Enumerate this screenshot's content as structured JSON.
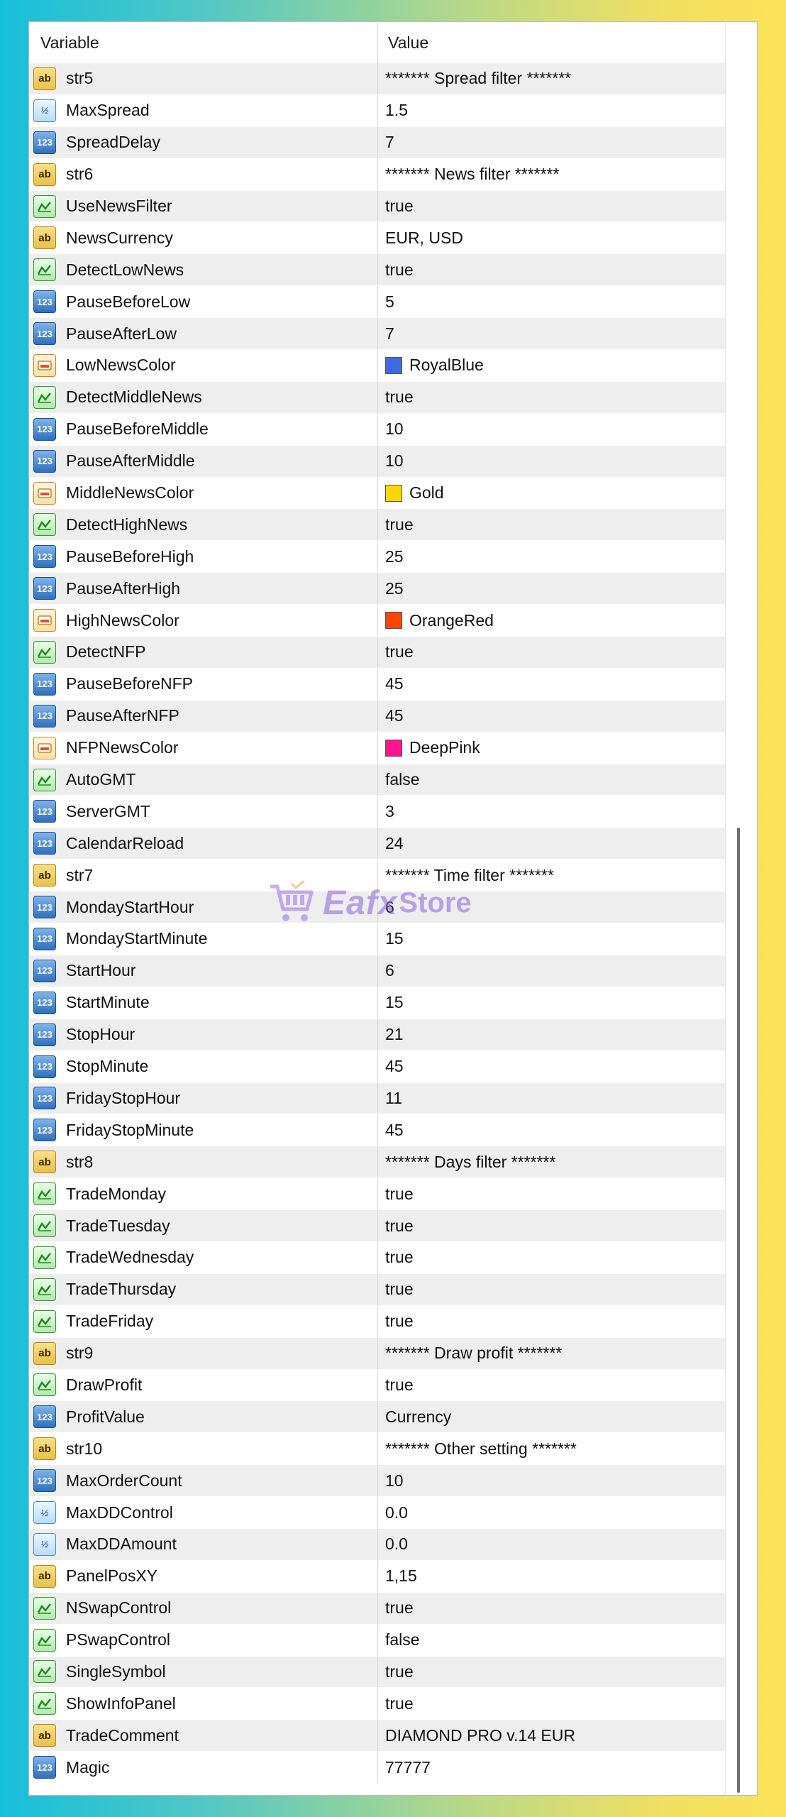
{
  "columns": {
    "variable": "Variable",
    "value": "Value"
  },
  "rows": [
    {
      "type": "string",
      "name": "str5",
      "value": "******* Spread filter *******"
    },
    {
      "type": "double",
      "name": "MaxSpread",
      "value": "1.5"
    },
    {
      "type": "int",
      "name": "SpreadDelay",
      "value": "7"
    },
    {
      "type": "string",
      "name": "str6",
      "value": "******* News filter *******"
    },
    {
      "type": "bool",
      "name": "UseNewsFilter",
      "value": "true"
    },
    {
      "type": "string",
      "name": "NewsCurrency",
      "value": "EUR, USD"
    },
    {
      "type": "bool",
      "name": "DetectLowNews",
      "value": "true"
    },
    {
      "type": "int",
      "name": "PauseBeforeLow",
      "value": "5"
    },
    {
      "type": "int",
      "name": "PauseAfterLow",
      "value": "7"
    },
    {
      "type": "color",
      "name": "LowNewsColor",
      "value": "RoyalBlue",
      "swatch": "#4169e1"
    },
    {
      "type": "bool",
      "name": "DetectMiddleNews",
      "value": "true"
    },
    {
      "type": "int",
      "name": "PauseBeforeMiddle",
      "value": "10"
    },
    {
      "type": "int",
      "name": "PauseAfterMiddle",
      "value": "10"
    },
    {
      "type": "color",
      "name": "MiddleNewsColor",
      "value": "Gold",
      "swatch": "#ffd700"
    },
    {
      "type": "bool",
      "name": "DetectHighNews",
      "value": "true"
    },
    {
      "type": "int",
      "name": "PauseBeforeHigh",
      "value": "25"
    },
    {
      "type": "int",
      "name": "PauseAfterHigh",
      "value": "25"
    },
    {
      "type": "color",
      "name": "HighNewsColor",
      "value": "OrangeRed",
      "swatch": "#ff4500"
    },
    {
      "type": "bool",
      "name": "DetectNFP",
      "value": "true"
    },
    {
      "type": "int",
      "name": "PauseBeforeNFP",
      "value": "45"
    },
    {
      "type": "int",
      "name": "PauseAfterNFP",
      "value": "45"
    },
    {
      "type": "color",
      "name": "NFPNewsColor",
      "value": "DeepPink",
      "swatch": "#ff1493"
    },
    {
      "type": "bool",
      "name": "AutoGMT",
      "value": "false"
    },
    {
      "type": "int",
      "name": "ServerGMT",
      "value": "3"
    },
    {
      "type": "int",
      "name": "CalendarReload",
      "value": "24"
    },
    {
      "type": "string",
      "name": "str7",
      "value": "******* Time filter *******"
    },
    {
      "type": "int",
      "name": "MondayStartHour",
      "value": "6"
    },
    {
      "type": "int",
      "name": "MondayStartMinute",
      "value": "15"
    },
    {
      "type": "int",
      "name": "StartHour",
      "value": "6"
    },
    {
      "type": "int",
      "name": "StartMinute",
      "value": "15"
    },
    {
      "type": "int",
      "name": "StopHour",
      "value": "21"
    },
    {
      "type": "int",
      "name": "StopMinute",
      "value": "45"
    },
    {
      "type": "int",
      "name": "FridayStopHour",
      "value": "11"
    },
    {
      "type": "int",
      "name": "FridayStopMinute",
      "value": "45"
    },
    {
      "type": "string",
      "name": "str8",
      "value": "******* Days filter *******"
    },
    {
      "type": "bool",
      "name": "TradeMonday",
      "value": "true"
    },
    {
      "type": "bool",
      "name": "TradeTuesday",
      "value": "true"
    },
    {
      "type": "bool",
      "name": "TradeWednesday",
      "value": "true"
    },
    {
      "type": "bool",
      "name": "TradeThursday",
      "value": "true"
    },
    {
      "type": "bool",
      "name": "TradeFriday",
      "value": "true"
    },
    {
      "type": "string",
      "name": "str9",
      "value": "******* Draw profit *******"
    },
    {
      "type": "bool",
      "name": "DrawProfit",
      "value": "true"
    },
    {
      "type": "int",
      "name": "ProfitValue",
      "value": "Currency"
    },
    {
      "type": "string",
      "name": "str10",
      "value": "******* Other setting *******"
    },
    {
      "type": "int",
      "name": "MaxOrderCount",
      "value": "10"
    },
    {
      "type": "double",
      "name": "MaxDDControl",
      "value": "0.0"
    },
    {
      "type": "double",
      "name": "MaxDDAmount",
      "value": "0.0"
    },
    {
      "type": "string",
      "name": "PanelPosXY",
      "value": "1,15"
    },
    {
      "type": "bool",
      "name": "NSwapControl",
      "value": "true"
    },
    {
      "type": "bool",
      "name": "PSwapControl",
      "value": "false"
    },
    {
      "type": "bool",
      "name": "SingleSymbol",
      "value": "true"
    },
    {
      "type": "bool",
      "name": "ShowInfoPanel",
      "value": "true"
    },
    {
      "type": "string",
      "name": "TradeComment",
      "value": "DIAMOND PRO v.14 EUR"
    },
    {
      "type": "int",
      "name": "Magic",
      "value": "77777"
    }
  ],
  "icons": {
    "string": {
      "name": "string-type-icon",
      "glyph": "ab"
    },
    "double": {
      "name": "double-type-icon",
      "glyph": "½"
    },
    "int": {
      "name": "integer-type-icon",
      "glyph": "123"
    },
    "bool": {
      "name": "bool-type-icon",
      "glyph": ""
    },
    "color": {
      "name": "color-type-icon",
      "glyph": ""
    }
  },
  "watermark": {
    "part1": "Eafx",
    "part2": "Store"
  }
}
